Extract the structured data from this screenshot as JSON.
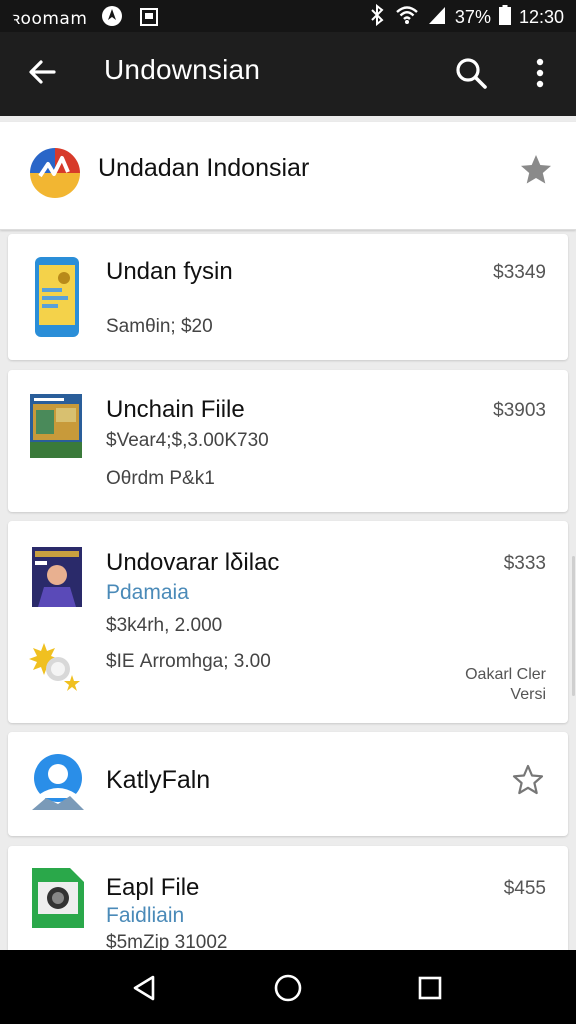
{
  "status_bar": {
    "carrier": "ꝛoomam",
    "battery_percent": "37%",
    "time": "12:30"
  },
  "app_bar": {
    "title": "Undownsian"
  },
  "header_item": {
    "title": "Undadan Indonsiar"
  },
  "items": [
    {
      "title": "Undan fysin",
      "price": "$3349",
      "line1": "Samθin; $20"
    },
    {
      "title": "Unchain Fiile",
      "price": "$3903",
      "line1": "$Vear4;$,3.00K730",
      "line2": "Oθrdm P&k1"
    },
    {
      "title": "Undovarar lδilac",
      "price": "$333",
      "link": "Pdamaia",
      "line1": "$3k4rh, 2.000",
      "line2": "$ΙΕ Arromhga; 3.00",
      "meta1": "Oakarl Cler",
      "meta2": "Versi"
    },
    {
      "title": "KatlyFaln"
    },
    {
      "title": "Eapl File",
      "price": "$455",
      "link": "Faidliain",
      "line1": "$5mZip 31002"
    }
  ],
  "colors": {
    "app_bar": "#1e1e1e",
    "status_bar": "#151515",
    "link": "#4a8ab8",
    "background": "#ececec"
  },
  "icons": [
    "carrier-logo-icon",
    "screenshot-icon",
    "bluetooth-icon",
    "wifi-icon",
    "signal-icon",
    "battery-icon",
    "back-arrow-icon",
    "search-icon",
    "more-vert-icon",
    "star-icon",
    "back-nav-icon",
    "home-nav-icon",
    "recents-nav-icon"
  ]
}
